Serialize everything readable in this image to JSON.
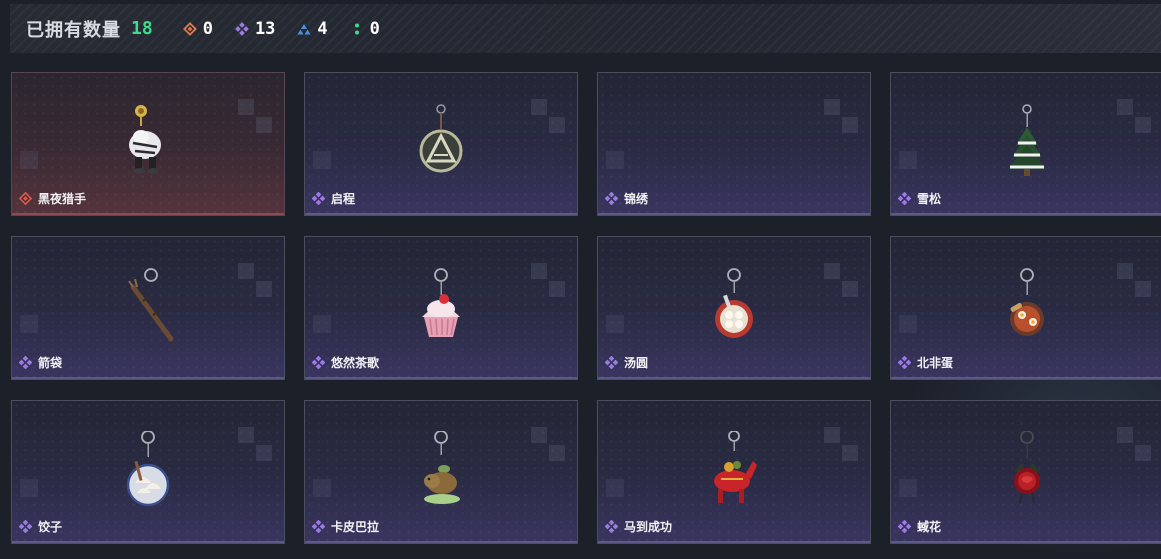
{
  "header": {
    "owned_label": "已拥有数量",
    "owned_count": "18",
    "stats": [
      {
        "icon": "orange-diamond-icon",
        "color": "#e07a4a",
        "value": "0"
      },
      {
        "icon": "purple-diamond-cluster-icon",
        "color": "#9a7be0",
        "value": "13"
      },
      {
        "icon": "blue-triangle-cluster-icon",
        "color": "#4a8fe0",
        "value": "4"
      },
      {
        "icon": "green-dots-icon",
        "color": "#3ddb8a",
        "value": "0"
      }
    ]
  },
  "items": [
    {
      "name": "黑夜猎手",
      "rarity": "red",
      "art": "white-tiger-charm-icon"
    },
    {
      "name": "启程",
      "rarity": "purple",
      "art": "triangle-medallion-charm-icon"
    },
    {
      "name": "锦绣",
      "rarity": "purple",
      "art": "empty"
    },
    {
      "name": "雪松",
      "rarity": "purple",
      "art": "snowy-pine-tree-charm-icon"
    },
    {
      "name": "箭袋",
      "rarity": "purple",
      "art": "quiver-charm-icon"
    },
    {
      "name": "悠然茶歌",
      "rarity": "purple",
      "art": "strawberry-cupcake-charm-icon"
    },
    {
      "name": "汤圆",
      "rarity": "purple",
      "art": "tangyuan-bowl-charm-icon"
    },
    {
      "name": "北非蛋",
      "rarity": "purple",
      "art": "shakshuka-pan-charm-icon"
    },
    {
      "name": "饺子",
      "rarity": "purple",
      "art": "dumpling-plate-charm-icon"
    },
    {
      "name": "卡皮巴拉",
      "rarity": "purple",
      "art": "capybara-charm-icon"
    },
    {
      "name": "马到成功",
      "rarity": "purple",
      "art": "red-horse-charm-icon"
    },
    {
      "name": "蜮花",
      "rarity": "purple",
      "art": "red-rose-charm-icon"
    }
  ]
}
